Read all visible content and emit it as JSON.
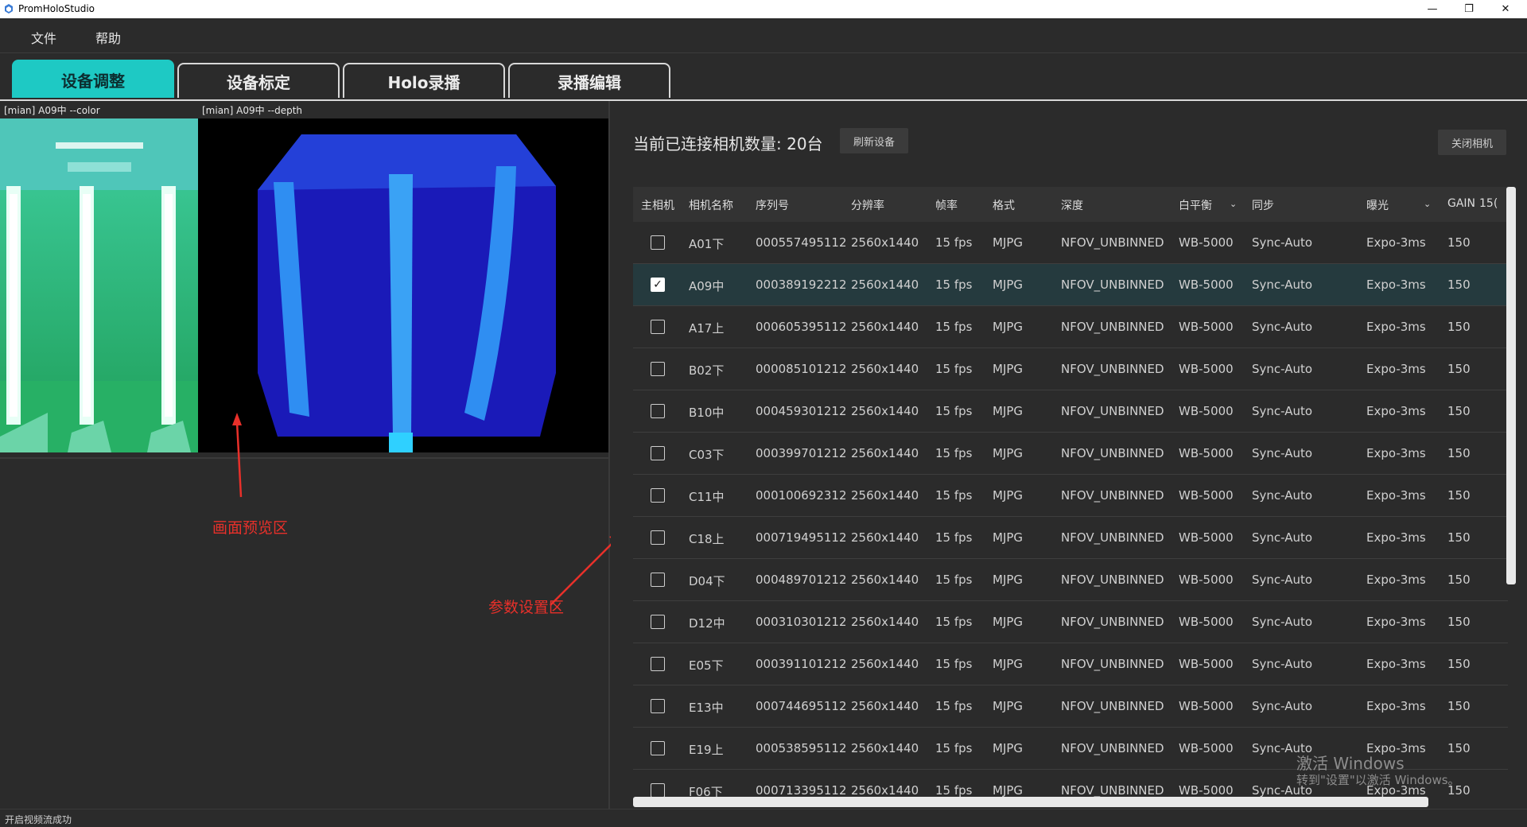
{
  "window": {
    "title": "PromHoloStudio",
    "minimize": "—",
    "restore": "❐",
    "close": "✕"
  },
  "menu": [
    "文件",
    "帮助"
  ],
  "tabs": [
    "设备调整",
    "设备标定",
    "Holo录播",
    "录播编辑"
  ],
  "preview": {
    "color_label": "[mian] A09中 --color",
    "depth_label": "[mian] A09中 --depth",
    "annotation": "画面预览区"
  },
  "params": {
    "annotation": "参数设置区",
    "count_text": "当前已连接相机数量: 20台",
    "refresh_button": "刷新设备",
    "close_camera_button": "关闭相机",
    "headers": [
      "主相机",
      "相机名称",
      "序列号",
      "分辨率",
      "帧率",
      "格式",
      "深度",
      "白平衡",
      "同步",
      "曝光",
      "GAIN",
      "15("
    ],
    "rows": [
      {
        "checked": false,
        "name": "A01下",
        "serial": "000557495112",
        "res": "2560x1440",
        "fps": "15 fps",
        "fmt": "MJPG",
        "depth": "NFOV_UNBINNED",
        "wb": "WB-5000",
        "sync": "Sync-Auto",
        "expo": "Expo-3ms",
        "gain": "150"
      },
      {
        "checked": true,
        "name": "A09中",
        "serial": "000389192212",
        "res": "2560x1440",
        "fps": "15 fps",
        "fmt": "MJPG",
        "depth": "NFOV_UNBINNED",
        "wb": "WB-5000",
        "sync": "Sync-Auto",
        "expo": "Expo-3ms",
        "gain": "150"
      },
      {
        "checked": false,
        "name": "A17上",
        "serial": "000605395112",
        "res": "2560x1440",
        "fps": "15 fps",
        "fmt": "MJPG",
        "depth": "NFOV_UNBINNED",
        "wb": "WB-5000",
        "sync": "Sync-Auto",
        "expo": "Expo-3ms",
        "gain": "150"
      },
      {
        "checked": false,
        "name": "B02下",
        "serial": "000085101212",
        "res": "2560x1440",
        "fps": "15 fps",
        "fmt": "MJPG",
        "depth": "NFOV_UNBINNED",
        "wb": "WB-5000",
        "sync": "Sync-Auto",
        "expo": "Expo-3ms",
        "gain": "150"
      },
      {
        "checked": false,
        "name": "B10中",
        "serial": "000459301212",
        "res": "2560x1440",
        "fps": "15 fps",
        "fmt": "MJPG",
        "depth": "NFOV_UNBINNED",
        "wb": "WB-5000",
        "sync": "Sync-Auto",
        "expo": "Expo-3ms",
        "gain": "150"
      },
      {
        "checked": false,
        "name": "C03下",
        "serial": "000399701212",
        "res": "2560x1440",
        "fps": "15 fps",
        "fmt": "MJPG",
        "depth": "NFOV_UNBINNED",
        "wb": "WB-5000",
        "sync": "Sync-Auto",
        "expo": "Expo-3ms",
        "gain": "150"
      },
      {
        "checked": false,
        "name": "C11中",
        "serial": "000100692312",
        "res": "2560x1440",
        "fps": "15 fps",
        "fmt": "MJPG",
        "depth": "NFOV_UNBINNED",
        "wb": "WB-5000",
        "sync": "Sync-Auto",
        "expo": "Expo-3ms",
        "gain": "150"
      },
      {
        "checked": false,
        "name": "C18上",
        "serial": "000719495112",
        "res": "2560x1440",
        "fps": "15 fps",
        "fmt": "MJPG",
        "depth": "NFOV_UNBINNED",
        "wb": "WB-5000",
        "sync": "Sync-Auto",
        "expo": "Expo-3ms",
        "gain": "150"
      },
      {
        "checked": false,
        "name": "D04下",
        "serial": "000489701212",
        "res": "2560x1440",
        "fps": "15 fps",
        "fmt": "MJPG",
        "depth": "NFOV_UNBINNED",
        "wb": "WB-5000",
        "sync": "Sync-Auto",
        "expo": "Expo-3ms",
        "gain": "150"
      },
      {
        "checked": false,
        "name": "D12中",
        "serial": "000310301212",
        "res": "2560x1440",
        "fps": "15 fps",
        "fmt": "MJPG",
        "depth": "NFOV_UNBINNED",
        "wb": "WB-5000",
        "sync": "Sync-Auto",
        "expo": "Expo-3ms",
        "gain": "150"
      },
      {
        "checked": false,
        "name": "E05下",
        "serial": "000391101212",
        "res": "2560x1440",
        "fps": "15 fps",
        "fmt": "MJPG",
        "depth": "NFOV_UNBINNED",
        "wb": "WB-5000",
        "sync": "Sync-Auto",
        "expo": "Expo-3ms",
        "gain": "150"
      },
      {
        "checked": false,
        "name": "E13中",
        "serial": "000744695112",
        "res": "2560x1440",
        "fps": "15 fps",
        "fmt": "MJPG",
        "depth": "NFOV_UNBINNED",
        "wb": "WB-5000",
        "sync": "Sync-Auto",
        "expo": "Expo-3ms",
        "gain": "150"
      },
      {
        "checked": false,
        "name": "E19上",
        "serial": "000538595112",
        "res": "2560x1440",
        "fps": "15 fps",
        "fmt": "MJPG",
        "depth": "NFOV_UNBINNED",
        "wb": "WB-5000",
        "sync": "Sync-Auto",
        "expo": "Expo-3ms",
        "gain": "150"
      },
      {
        "checked": false,
        "name": "F06下",
        "serial": "000713395112",
        "res": "2560x1440",
        "fps": "15 fps",
        "fmt": "MJPG",
        "depth": "NFOV_UNBINNED",
        "wb": "WB-5000",
        "sync": "Sync-Auto",
        "expo": "Expo-3ms",
        "gain": "150"
      }
    ]
  },
  "watermark": {
    "line1": "激活 Windows",
    "line2": "转到\"设置\"以激活 Windows。"
  },
  "status": "开启视频流成功",
  "colors": {
    "accent": "#1ec9c4",
    "background": "#2b2b2b",
    "annotation": "#e8302a"
  }
}
